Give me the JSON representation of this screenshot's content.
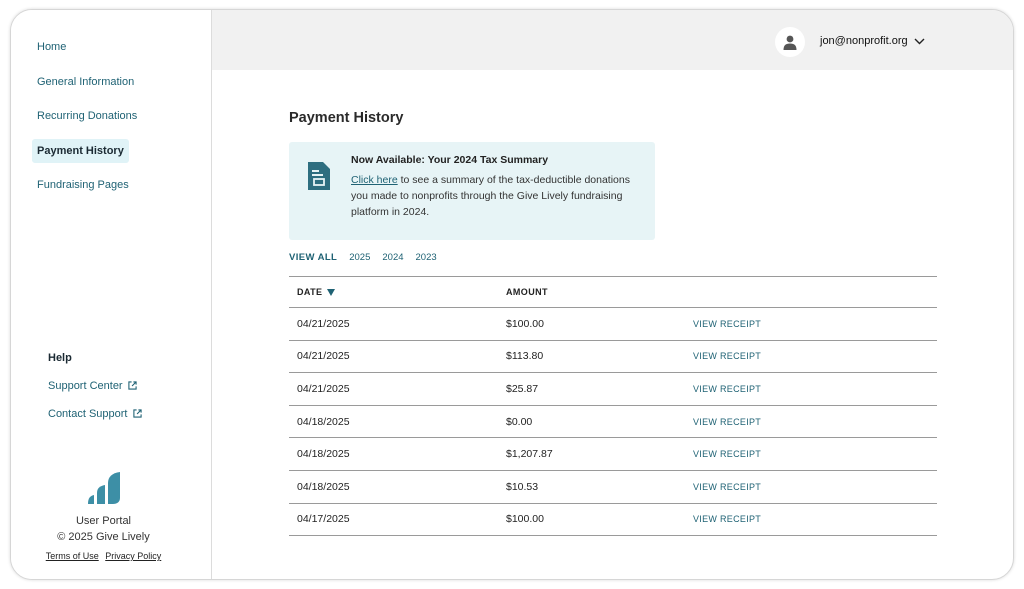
{
  "sidebar": {
    "items": [
      {
        "label": "Home"
      },
      {
        "label": "General Information"
      },
      {
        "label": "Recurring Donations"
      },
      {
        "label": "Payment History"
      },
      {
        "label": "Fundraising Pages"
      }
    ],
    "help": {
      "title": "Help",
      "support_center": "Support Center",
      "contact_support": "Contact Support"
    },
    "brand": {
      "product": "User Portal",
      "copyright": "© 2025 Give Lively",
      "terms": "Terms of Use",
      "privacy": "Privacy Policy"
    }
  },
  "header": {
    "user_email": "jon@nonprofit.org"
  },
  "main": {
    "title": "Payment History",
    "banner": {
      "title": "Now Available: Your 2024 Tax Summary",
      "link_text": "Click here",
      "body": " to see a summary of the tax-deductible donations you made to nonprofits through the Give Lively fundraising platform in 2024."
    },
    "filters": [
      "VIEW ALL",
      "2025",
      "2024",
      "2023"
    ],
    "table": {
      "headers": {
        "date": "DATE",
        "amount": "AMOUNT"
      },
      "rows": [
        {
          "date": "04/21/2025",
          "amount": "$100.00",
          "action": "VIEW RECEIPT"
        },
        {
          "date": "04/21/2025",
          "amount": "$113.80",
          "action": "VIEW RECEIPT"
        },
        {
          "date": "04/21/2025",
          "amount": "$25.87",
          "action": "VIEW RECEIPT"
        },
        {
          "date": "04/18/2025",
          "amount": "$0.00",
          "action": "VIEW RECEIPT"
        },
        {
          "date": "04/18/2025",
          "amount": "$1,207.87",
          "action": "VIEW RECEIPT"
        },
        {
          "date": "04/18/2025",
          "amount": "$10.53",
          "action": "VIEW RECEIPT"
        },
        {
          "date": "04/17/2025",
          "amount": "$100.00",
          "action": "VIEW RECEIPT"
        }
      ]
    }
  },
  "icons": {
    "avatar": "user-icon",
    "chevron": "chevron-down-icon",
    "document": "document-icon",
    "external": "external-link-icon",
    "sort": "sort-down-icon",
    "logo": "give-lively-logo"
  },
  "colors": {
    "accent": "#1f6274",
    "active_nav_bg": "#e0f3f7",
    "banner_bg": "#e7f4f6",
    "header_bg": "#f1f1f1",
    "logo": "#3d8fa6"
  }
}
